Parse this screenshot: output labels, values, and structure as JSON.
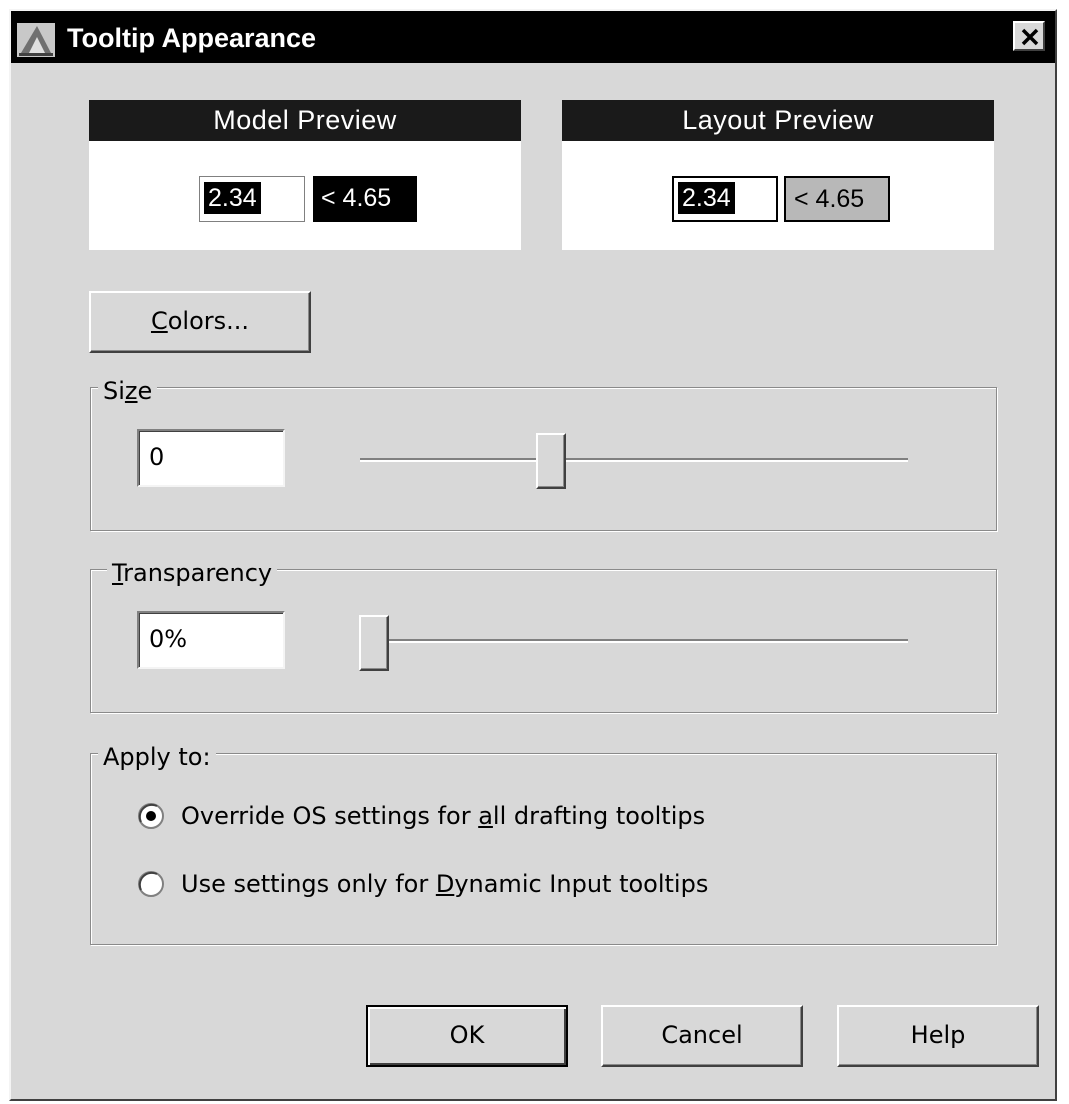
{
  "window": {
    "title": "Tooltip Appearance"
  },
  "model_preview": {
    "header": "Model Preview",
    "distance": "2.34",
    "angle": "< 4.65"
  },
  "layout_preview": {
    "header": "Layout Preview",
    "distance": "2.34",
    "angle": "< 4.65"
  },
  "colors_button": {
    "label_mnemonic": "C",
    "label_rest": "olors..."
  },
  "size": {
    "legend_pre": "Si",
    "legend_mnemonic": "z",
    "legend_post": "e",
    "value": "0",
    "slider_fraction": 0.34
  },
  "transparency": {
    "legend_mnemonic": "T",
    "legend_post": "ransparency",
    "value": "0%",
    "slider_fraction": 0.0
  },
  "apply_to": {
    "legend": "Apply to:",
    "options": [
      {
        "pre": "Override OS settings for ",
        "mnemonic": "a",
        "post": "ll drafting tooltips",
        "selected": true
      },
      {
        "pre": "Use settings only for ",
        "mnemonic": "D",
        "post": "ynamic Input tooltips",
        "selected": false
      }
    ]
  },
  "buttons": {
    "ok": "OK",
    "cancel": "Cancel",
    "help": "Help"
  },
  "icons": {
    "app": "autocad-app-icon",
    "close": "close-icon"
  },
  "colors": {
    "model_angle_bg": "#000000",
    "layout_angle_bg": "#b8b8b8",
    "dialog_bg": "#d8d8d8",
    "titlebar_bg": "#000000"
  }
}
